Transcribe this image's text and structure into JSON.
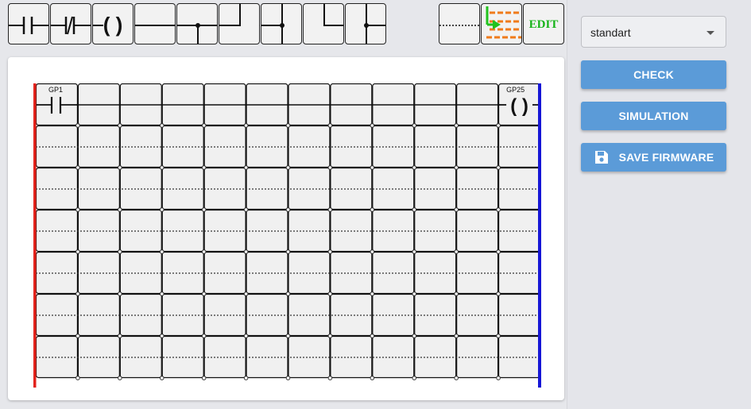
{
  "toolbar": {
    "tools": [
      {
        "name": "contact-no-tool"
      },
      {
        "name": "contact-nc-tool"
      },
      {
        "name": "coil-tool",
        "glyph": "( )"
      },
      {
        "name": "horizontal-line-tool"
      },
      {
        "name": "branch-down-tool"
      },
      {
        "name": "corner-up-tool"
      },
      {
        "name": "branch-left-tool"
      },
      {
        "name": "corner-left-tool"
      },
      {
        "name": "branch-right-tool"
      },
      {
        "name": "dotted-line-tool"
      },
      {
        "name": "run-rungs-tool"
      },
      {
        "name": "edit-tool",
        "label": "EDIT"
      }
    ]
  },
  "ladder": {
    "columns": 12,
    "rows": 7,
    "rung1": {
      "contact_label": "GP1",
      "coil_label": "GP25",
      "coil_glyph": "( )"
    },
    "colors": {
      "left_rail": "#e3221b",
      "right_rail": "#1616d6",
      "cell_bg": "#f0f0f0"
    }
  },
  "sidebar": {
    "mode_select": {
      "value": "standart"
    },
    "check_label": "CHECK",
    "simulation_label": "SIMULATION",
    "save_label": "SAVE FIRMWARE",
    "accent": "#5b9bd8"
  }
}
